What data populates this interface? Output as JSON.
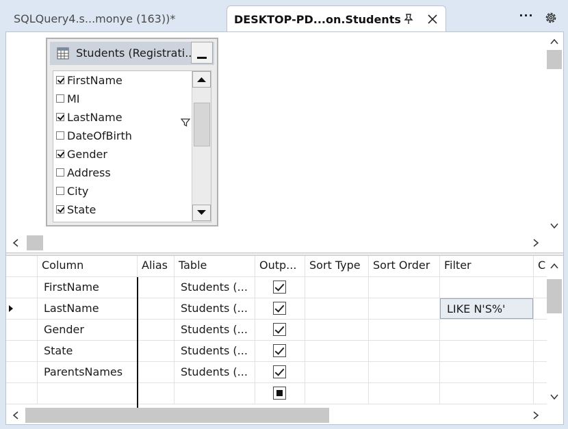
{
  "tabs": [
    {
      "title": "SQLQuery4.s...monye (163))*",
      "active": false
    },
    {
      "title": "DESKTOP-PD...on.Students",
      "active": true
    }
  ],
  "strip": {
    "more_icon": "ellipsis-icon",
    "settings_icon": "gear-icon"
  },
  "diagram": {
    "table_title": "Students (Registrati...",
    "columns": [
      {
        "name": "FirstName",
        "checked": true
      },
      {
        "name": "MI",
        "checked": false
      },
      {
        "name": "LastName",
        "checked": true,
        "filter": true
      },
      {
        "name": "DateOfBirth",
        "checked": false
      },
      {
        "name": "Gender",
        "checked": true
      },
      {
        "name": "Address",
        "checked": false
      },
      {
        "name": "City",
        "checked": false
      },
      {
        "name": "State",
        "checked": true
      }
    ]
  },
  "grid": {
    "headers": [
      "Column",
      "Alias",
      "Table",
      "Outp...",
      "Sort Type",
      "Sort Order",
      "Filter",
      "C"
    ],
    "rows": [
      {
        "column": "FirstName",
        "alias": "",
        "table": "Students (...",
        "output": "checked",
        "sort_type": "",
        "sort_order": "",
        "filter": "",
        "selected": false
      },
      {
        "column": "LastName",
        "alias": "",
        "table": "Students (...",
        "output": "checked",
        "sort_type": "",
        "sort_order": "",
        "filter": "LIKE N'S%'",
        "selected": true
      },
      {
        "column": "Gender",
        "alias": "",
        "table": "Students (...",
        "output": "checked",
        "sort_type": "",
        "sort_order": "",
        "filter": "",
        "selected": false
      },
      {
        "column": "State",
        "alias": "",
        "table": "Students (...",
        "output": "checked",
        "sort_type": "",
        "sort_order": "",
        "filter": "",
        "selected": false
      },
      {
        "column": "ParentsNames",
        "alias": "",
        "table": "Students (...",
        "output": "checked",
        "sort_type": "",
        "sort_order": "",
        "filter": "",
        "selected": false
      },
      {
        "column": "",
        "alias": "",
        "table": "",
        "output": "indeterminate",
        "sort_type": "",
        "sort_order": "",
        "filter": "",
        "selected": false
      }
    ]
  },
  "colors": {
    "tab_strip": "#dde6f3",
    "active_tab": "#ffffff",
    "scroll_thumb": "#c8c8c8",
    "filter_cell": "#e7ebf2"
  }
}
